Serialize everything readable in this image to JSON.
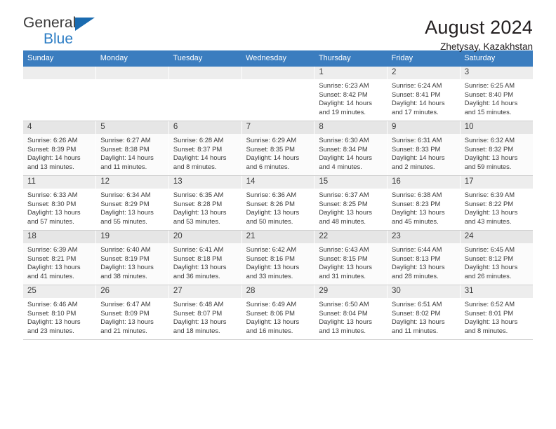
{
  "brand": {
    "name_top": "General",
    "name_bottom": "Blue",
    "accent_color": "#2b7cc4",
    "triangle_color": "#1a6bb0"
  },
  "header": {
    "title": "August 2024",
    "subtitle": "Zhetysay, Kazakhstan"
  },
  "calendar": {
    "header_bg": "#3b7dbf",
    "weekdays": [
      "Sunday",
      "Monday",
      "Tuesday",
      "Wednesday",
      "Thursday",
      "Friday",
      "Saturday"
    ],
    "weeks": [
      [
        {
          "day": "",
          "sunrise": "",
          "sunset": "",
          "daylight_1": "",
          "daylight_2": ""
        },
        {
          "day": "",
          "sunrise": "",
          "sunset": "",
          "daylight_1": "",
          "daylight_2": ""
        },
        {
          "day": "",
          "sunrise": "",
          "sunset": "",
          "daylight_1": "",
          "daylight_2": ""
        },
        {
          "day": "",
          "sunrise": "",
          "sunset": "",
          "daylight_1": "",
          "daylight_2": ""
        },
        {
          "day": "1",
          "sunrise": "Sunrise: 6:23 AM",
          "sunset": "Sunset: 8:42 PM",
          "daylight_1": "Daylight: 14 hours",
          "daylight_2": "and 19 minutes."
        },
        {
          "day": "2",
          "sunrise": "Sunrise: 6:24 AM",
          "sunset": "Sunset: 8:41 PM",
          "daylight_1": "Daylight: 14 hours",
          "daylight_2": "and 17 minutes."
        },
        {
          "day": "3",
          "sunrise": "Sunrise: 6:25 AM",
          "sunset": "Sunset: 8:40 PM",
          "daylight_1": "Daylight: 14 hours",
          "daylight_2": "and 15 minutes."
        }
      ],
      [
        {
          "day": "4",
          "sunrise": "Sunrise: 6:26 AM",
          "sunset": "Sunset: 8:39 PM",
          "daylight_1": "Daylight: 14 hours",
          "daylight_2": "and 13 minutes."
        },
        {
          "day": "5",
          "sunrise": "Sunrise: 6:27 AM",
          "sunset": "Sunset: 8:38 PM",
          "daylight_1": "Daylight: 14 hours",
          "daylight_2": "and 11 minutes."
        },
        {
          "day": "6",
          "sunrise": "Sunrise: 6:28 AM",
          "sunset": "Sunset: 8:37 PM",
          "daylight_1": "Daylight: 14 hours",
          "daylight_2": "and 8 minutes."
        },
        {
          "day": "7",
          "sunrise": "Sunrise: 6:29 AM",
          "sunset": "Sunset: 8:35 PM",
          "daylight_1": "Daylight: 14 hours",
          "daylight_2": "and 6 minutes."
        },
        {
          "day": "8",
          "sunrise": "Sunrise: 6:30 AM",
          "sunset": "Sunset: 8:34 PM",
          "daylight_1": "Daylight: 14 hours",
          "daylight_2": "and 4 minutes."
        },
        {
          "day": "9",
          "sunrise": "Sunrise: 6:31 AM",
          "sunset": "Sunset: 8:33 PM",
          "daylight_1": "Daylight: 14 hours",
          "daylight_2": "and 2 minutes."
        },
        {
          "day": "10",
          "sunrise": "Sunrise: 6:32 AM",
          "sunset": "Sunset: 8:32 PM",
          "daylight_1": "Daylight: 13 hours",
          "daylight_2": "and 59 minutes."
        }
      ],
      [
        {
          "day": "11",
          "sunrise": "Sunrise: 6:33 AM",
          "sunset": "Sunset: 8:30 PM",
          "daylight_1": "Daylight: 13 hours",
          "daylight_2": "and 57 minutes."
        },
        {
          "day": "12",
          "sunrise": "Sunrise: 6:34 AM",
          "sunset": "Sunset: 8:29 PM",
          "daylight_1": "Daylight: 13 hours",
          "daylight_2": "and 55 minutes."
        },
        {
          "day": "13",
          "sunrise": "Sunrise: 6:35 AM",
          "sunset": "Sunset: 8:28 PM",
          "daylight_1": "Daylight: 13 hours",
          "daylight_2": "and 53 minutes."
        },
        {
          "day": "14",
          "sunrise": "Sunrise: 6:36 AM",
          "sunset": "Sunset: 8:26 PM",
          "daylight_1": "Daylight: 13 hours",
          "daylight_2": "and 50 minutes."
        },
        {
          "day": "15",
          "sunrise": "Sunrise: 6:37 AM",
          "sunset": "Sunset: 8:25 PM",
          "daylight_1": "Daylight: 13 hours",
          "daylight_2": "and 48 minutes."
        },
        {
          "day": "16",
          "sunrise": "Sunrise: 6:38 AM",
          "sunset": "Sunset: 8:23 PM",
          "daylight_1": "Daylight: 13 hours",
          "daylight_2": "and 45 minutes."
        },
        {
          "day": "17",
          "sunrise": "Sunrise: 6:39 AM",
          "sunset": "Sunset: 8:22 PM",
          "daylight_1": "Daylight: 13 hours",
          "daylight_2": "and 43 minutes."
        }
      ],
      [
        {
          "day": "18",
          "sunrise": "Sunrise: 6:39 AM",
          "sunset": "Sunset: 8:21 PM",
          "daylight_1": "Daylight: 13 hours",
          "daylight_2": "and 41 minutes."
        },
        {
          "day": "19",
          "sunrise": "Sunrise: 6:40 AM",
          "sunset": "Sunset: 8:19 PM",
          "daylight_1": "Daylight: 13 hours",
          "daylight_2": "and 38 minutes."
        },
        {
          "day": "20",
          "sunrise": "Sunrise: 6:41 AM",
          "sunset": "Sunset: 8:18 PM",
          "daylight_1": "Daylight: 13 hours",
          "daylight_2": "and 36 minutes."
        },
        {
          "day": "21",
          "sunrise": "Sunrise: 6:42 AM",
          "sunset": "Sunset: 8:16 PM",
          "daylight_1": "Daylight: 13 hours",
          "daylight_2": "and 33 minutes."
        },
        {
          "day": "22",
          "sunrise": "Sunrise: 6:43 AM",
          "sunset": "Sunset: 8:15 PM",
          "daylight_1": "Daylight: 13 hours",
          "daylight_2": "and 31 minutes."
        },
        {
          "day": "23",
          "sunrise": "Sunrise: 6:44 AM",
          "sunset": "Sunset: 8:13 PM",
          "daylight_1": "Daylight: 13 hours",
          "daylight_2": "and 28 minutes."
        },
        {
          "day": "24",
          "sunrise": "Sunrise: 6:45 AM",
          "sunset": "Sunset: 8:12 PM",
          "daylight_1": "Daylight: 13 hours",
          "daylight_2": "and 26 minutes."
        }
      ],
      [
        {
          "day": "25",
          "sunrise": "Sunrise: 6:46 AM",
          "sunset": "Sunset: 8:10 PM",
          "daylight_1": "Daylight: 13 hours",
          "daylight_2": "and 23 minutes."
        },
        {
          "day": "26",
          "sunrise": "Sunrise: 6:47 AM",
          "sunset": "Sunset: 8:09 PM",
          "daylight_1": "Daylight: 13 hours",
          "daylight_2": "and 21 minutes."
        },
        {
          "day": "27",
          "sunrise": "Sunrise: 6:48 AM",
          "sunset": "Sunset: 8:07 PM",
          "daylight_1": "Daylight: 13 hours",
          "daylight_2": "and 18 minutes."
        },
        {
          "day": "28",
          "sunrise": "Sunrise: 6:49 AM",
          "sunset": "Sunset: 8:06 PM",
          "daylight_1": "Daylight: 13 hours",
          "daylight_2": "and 16 minutes."
        },
        {
          "day": "29",
          "sunrise": "Sunrise: 6:50 AM",
          "sunset": "Sunset: 8:04 PM",
          "daylight_1": "Daylight: 13 hours",
          "daylight_2": "and 13 minutes."
        },
        {
          "day": "30",
          "sunrise": "Sunrise: 6:51 AM",
          "sunset": "Sunset: 8:02 PM",
          "daylight_1": "Daylight: 13 hours",
          "daylight_2": "and 11 minutes."
        },
        {
          "day": "31",
          "sunrise": "Sunrise: 6:52 AM",
          "sunset": "Sunset: 8:01 PM",
          "daylight_1": "Daylight: 13 hours",
          "daylight_2": "and 8 minutes."
        }
      ]
    ]
  }
}
